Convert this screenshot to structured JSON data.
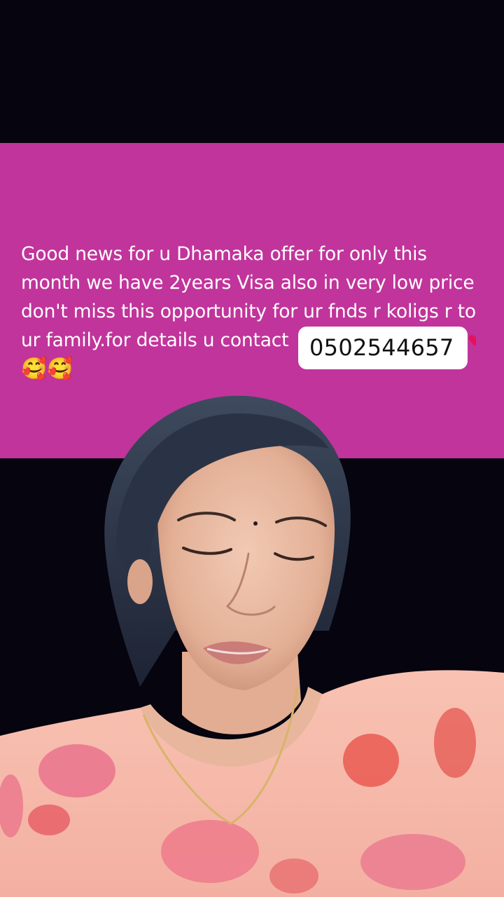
{
  "banner": {
    "message": "Good news for u Dhamaka offer for only this month we have 2years Visa also in very low price don't miss this opportunity for ur fnds r koligs r to ur family.for details u contact",
    "emojis": "🥰🥰",
    "phone_number": "0502544657",
    "background_color": "#c1349b"
  },
  "video": {
    "background_color": "#05040f",
    "subject": "woman speaking to camera, eyes closed, wearing pink floral top and gold chain"
  }
}
